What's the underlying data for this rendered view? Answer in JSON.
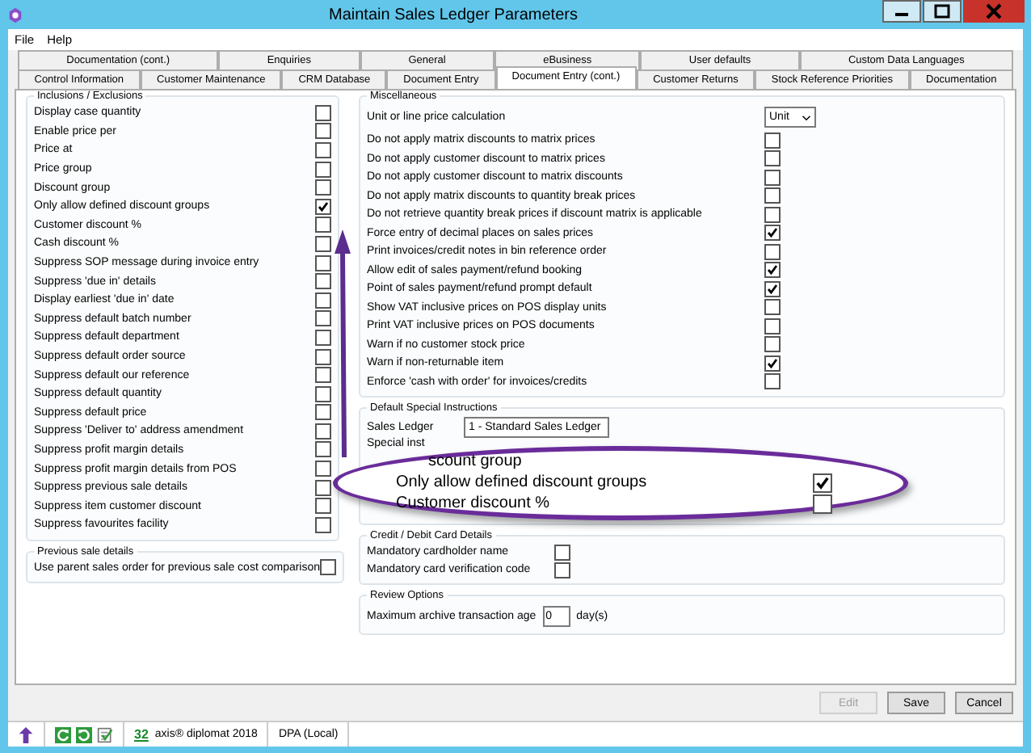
{
  "window": {
    "title": "Maintain Sales Ledger Parameters"
  },
  "menu": [
    "File",
    "Help"
  ],
  "tabs_back": [
    {
      "label": "Documentation (cont.)",
      "selected": false
    },
    {
      "label": "Enquiries",
      "selected": false
    },
    {
      "label": "General",
      "selected": false
    },
    {
      "label": "eBusiness",
      "selected": false
    },
    {
      "label": "User defaults",
      "selected": false
    },
    {
      "label": "Custom Data Languages",
      "selected": false
    }
  ],
  "tabs_front": [
    {
      "label": "Control Information",
      "selected": false
    },
    {
      "label": "Customer Maintenance",
      "selected": false
    },
    {
      "label": "CRM Database",
      "selected": false
    },
    {
      "label": "Document Entry",
      "selected": false
    },
    {
      "label": "Document Entry (cont.)",
      "selected": true
    },
    {
      "label": "Customer Returns",
      "selected": false
    },
    {
      "label": "Stock Reference Priorities",
      "selected": false
    },
    {
      "label": "Documentation",
      "selected": false
    }
  ],
  "inclusions": {
    "title": "Inclusions / Exclusions",
    "items": [
      {
        "label": "Display case quantity",
        "checked": false
      },
      {
        "label": "Enable price per",
        "checked": false
      },
      {
        "label": "Price at",
        "checked": false
      },
      {
        "label": "Price group",
        "checked": false
      },
      {
        "label": "Discount group",
        "checked": false
      },
      {
        "label": "Only allow defined discount groups",
        "checked": true
      },
      {
        "label": "Customer discount %",
        "checked": false
      },
      {
        "label": "Cash discount %",
        "checked": false
      },
      {
        "label": "Suppress SOP message during invoice entry",
        "checked": false
      },
      {
        "label": "Suppress 'due in' details",
        "checked": false
      },
      {
        "label": "Display earliest 'due in' date",
        "checked": false
      },
      {
        "label": "Suppress default batch number",
        "checked": false
      },
      {
        "label": "Suppress default department",
        "checked": false
      },
      {
        "label": "Suppress default order source",
        "checked": false
      },
      {
        "label": "Suppress default our reference",
        "checked": false
      },
      {
        "label": "Suppress default quantity",
        "checked": false
      },
      {
        "label": "Suppress default price",
        "checked": false
      },
      {
        "label": "Suppress 'Deliver to' address amendment",
        "checked": false
      },
      {
        "label": "Suppress profit margin details",
        "checked": false
      },
      {
        "label": "Suppress profit margin details from POS",
        "checked": false
      },
      {
        "label": "Suppress previous sale details",
        "checked": false
      },
      {
        "label": "Suppress item customer discount",
        "checked": false
      },
      {
        "label": "Suppress favourites facility",
        "checked": false
      }
    ]
  },
  "previous_sale": {
    "title": "Previous sale details",
    "items": [
      {
        "label": "Use parent sales order for previous sale cost comparison",
        "checked": false
      }
    ]
  },
  "miscellaneous": {
    "title": "Miscellaneous",
    "price_calc": {
      "label": "Unit or line price calculation",
      "value": "Unit"
    },
    "items": [
      {
        "label": "Do not apply matrix discounts to matrix prices",
        "checked": false
      },
      {
        "label": "Do not apply customer discount to matrix prices",
        "checked": false
      },
      {
        "label": "Do not apply customer discount to matrix discounts",
        "checked": false
      },
      {
        "label": "Do not apply matrix discounts to quantity break prices",
        "checked": false
      },
      {
        "label": "Do not retrieve quantity break prices if discount matrix is applicable",
        "checked": false
      },
      {
        "label": "Force entry of decimal places on sales prices",
        "checked": true
      },
      {
        "label": "Print invoices/credit notes in bin reference order",
        "checked": false
      },
      {
        "label": "Allow edit of sales payment/refund booking",
        "checked": true
      },
      {
        "label": "Point of sales payment/refund prompt default",
        "checked": true
      },
      {
        "label": "Show VAT inclusive prices on POS display units",
        "checked": false
      },
      {
        "label": "Print VAT inclusive prices on POS documents",
        "checked": false
      },
      {
        "label": "Warn if no customer stock price",
        "checked": false
      },
      {
        "label": "Warn if non-returnable item",
        "checked": true
      },
      {
        "label": "Enforce 'cash with order' for invoices/credits",
        "checked": false
      }
    ]
  },
  "special_instructions": {
    "title": "Default Special Instructions",
    "sales_ledger": {
      "label": "Sales Ledger",
      "value": "1 - Standard Sales Ledger"
    },
    "instructions_label": "Special inst"
  },
  "callout": {
    "heading": "scount group",
    "items": [
      {
        "label": "Only allow defined discount groups",
        "checked": true
      },
      {
        "label": "Customer discount %",
        "checked": false
      }
    ]
  },
  "card_details": {
    "title": "Credit / Debit Card Details",
    "items": [
      {
        "label": "Mandatory cardholder name",
        "checked": false
      },
      {
        "label": "Mandatory card verification code",
        "checked": false
      }
    ]
  },
  "review": {
    "title": "Review Options",
    "label": "Maximum archive transaction age",
    "value": "0",
    "unit": "day(s)"
  },
  "buttons": [
    {
      "label": "Edit",
      "disabled": true
    },
    {
      "label": "Save",
      "disabled": false
    },
    {
      "label": "Cancel",
      "disabled": false
    }
  ],
  "status_bar": {
    "count": "32",
    "product": "axis® diplomat 2018",
    "database": "DPA (Local)"
  }
}
